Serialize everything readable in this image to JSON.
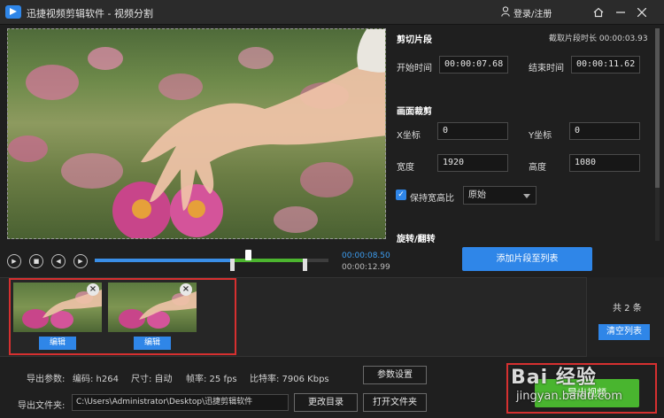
{
  "window": {
    "title": "迅捷视频剪辑软件 - 视频分割",
    "login": "登录/注册",
    "home_icon": "home-icon",
    "minimize_icon": "minimize-icon",
    "close_icon": "close-icon"
  },
  "clip": {
    "section_title": "剪切片段",
    "duration_label": "截取片段时长 00:00:03.93",
    "start_label": "开始时间",
    "start_value": "00:00:07.68",
    "end_label": "结束时间",
    "end_value": "00:00:11.62"
  },
  "crop": {
    "section_title": "画面裁剪",
    "x_label": "X坐标",
    "x_value": "0",
    "y_label": "Y坐标",
    "y_value": "0",
    "width_label": "宽度",
    "width_value": "1920",
    "height_label": "高度",
    "height_value": "1080",
    "keep_ratio_label": "保持宽高比",
    "ratio_value": "原始"
  },
  "rotate": {
    "section_title": "旋转/翻转"
  },
  "player": {
    "current_time": "00:00:08.50",
    "total_time": "00:00:12.99",
    "played_fraction": 0.654,
    "selection_start_fraction": 0.591,
    "selection_end_fraction": 0.897
  },
  "add_button": "添加片段至列表",
  "clips": {
    "items": [
      {
        "edit_label": "编辑"
      },
      {
        "edit_label": "编辑"
      }
    ],
    "count_label": "共 2 条",
    "clear_button": "清空列表"
  },
  "export": {
    "params_label": "导出参数:",
    "codec": "编码: h264",
    "size": "尺寸: 自动",
    "fps": "帧率: 25 fps",
    "bitrate": "比特率: 7906 Kbps",
    "params_button": "参数设置",
    "folder_label": "导出文件夹:",
    "folder_path": "C:\\Users\\Administrator\\Desktop\\迅捷剪辑软件",
    "change_dir_button": "更改目录",
    "open_folder_button": "打开文件夹",
    "export_button": "导出视频"
  },
  "watermark": {
    "main": "Bai 经验",
    "sub": "jingyan.baidu.com"
  },
  "colors": {
    "accent": "#2f86e8",
    "export_green": "#49b52f",
    "highlight_red": "#d63030",
    "selection_green": "#4cb52f"
  }
}
